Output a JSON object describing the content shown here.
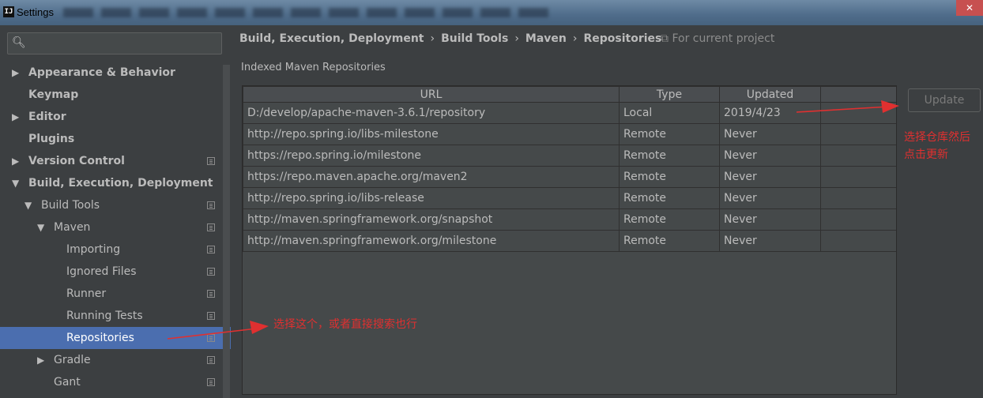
{
  "window": {
    "title": "Settings",
    "app_icon_text": "IJ",
    "close_glyph": "✕"
  },
  "search": {
    "value": "",
    "placeholder": "",
    "icon": "search-icon"
  },
  "sidebar": {
    "items": [
      {
        "label": "Appearance & Behavior",
        "arrow": "▶",
        "bold": true
      },
      {
        "label": "Keymap",
        "arrow": "",
        "bold": true
      },
      {
        "label": "Editor",
        "arrow": "▶",
        "bold": true
      },
      {
        "label": "Plugins",
        "arrow": "",
        "bold": true
      },
      {
        "label": "Version Control",
        "arrow": "▶",
        "bold": true
      },
      {
        "label": "Build, Execution, Deployment",
        "arrow": "▼",
        "bold": true
      },
      {
        "label": "Build Tools",
        "arrow": "▼",
        "bold": false
      },
      {
        "label": "Maven",
        "arrow": "▼",
        "bold": false
      },
      {
        "label": "Importing",
        "arrow": "",
        "bold": false
      },
      {
        "label": "Ignored Files",
        "arrow": "",
        "bold": false
      },
      {
        "label": "Runner",
        "arrow": "",
        "bold": false
      },
      {
        "label": "Running Tests",
        "arrow": "",
        "bold": false
      },
      {
        "label": "Repositories",
        "arrow": "",
        "bold": false,
        "selected": true
      },
      {
        "label": "Gradle",
        "arrow": "▶",
        "bold": false
      },
      {
        "label": "Gant",
        "arrow": "",
        "bold": false
      }
    ]
  },
  "breadcrumb": {
    "parts": [
      "Build, Execution, Deployment",
      "Build Tools",
      "Maven",
      "Repositories"
    ],
    "separator": "›",
    "scope": "For current project"
  },
  "section": {
    "title": "Indexed Maven Repositories"
  },
  "table": {
    "headers": [
      "URL",
      "Type",
      "Updated",
      ""
    ],
    "rows": [
      [
        "D:/develop/apache-maven-3.6.1/repository",
        "Local",
        "2019/4/23",
        ""
      ],
      [
        "http://repo.spring.io/libs-milestone",
        "Remote",
        "Never",
        ""
      ],
      [
        "https://repo.spring.io/milestone",
        "Remote",
        "Never",
        ""
      ],
      [
        "https://repo.maven.apache.org/maven2",
        "Remote",
        "Never",
        ""
      ],
      [
        "http://repo.spring.io/libs-release",
        "Remote",
        "Never",
        ""
      ],
      [
        "http://maven.springframework.org/snapshot",
        "Remote",
        "Never",
        ""
      ],
      [
        "http://maven.springframework.org/milestone",
        "Remote",
        "Never",
        ""
      ]
    ]
  },
  "buttons": {
    "update": "Update"
  },
  "annotations": {
    "right_note_line1": "选择仓库然后",
    "right_note_line2": "点击更新",
    "left_note": "选择这个，或者直接搜索也行",
    "color": "#e03030"
  }
}
